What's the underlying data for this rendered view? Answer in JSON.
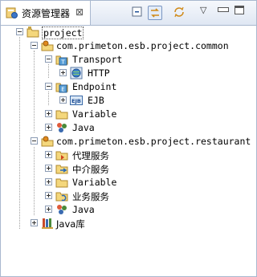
{
  "tab": {
    "title": "资源管理器",
    "close": "⊠",
    "icon": "explorer-icon"
  },
  "toolbar": {
    "collapse": "collapse-all-icon",
    "link": "link-with-editor-icon",
    "sync": "sync-icon",
    "menu": "▽",
    "minimize": "▭",
    "maximize": "□"
  },
  "tree": {
    "project": "project",
    "common": "com.primeton.esb.project.common",
    "transport": "Transport",
    "http": "HTTP",
    "endpoint": "Endpoint",
    "ejb": "EJB",
    "variable1": "Variable",
    "java1": "Java",
    "restaurant": "com.primeton.esb.project.restaurant",
    "proxy": "代理服务",
    "mediation": "中介服务",
    "variable2": "Variable",
    "business": "业务服务",
    "java2": "Java",
    "javalib": "Java库"
  }
}
